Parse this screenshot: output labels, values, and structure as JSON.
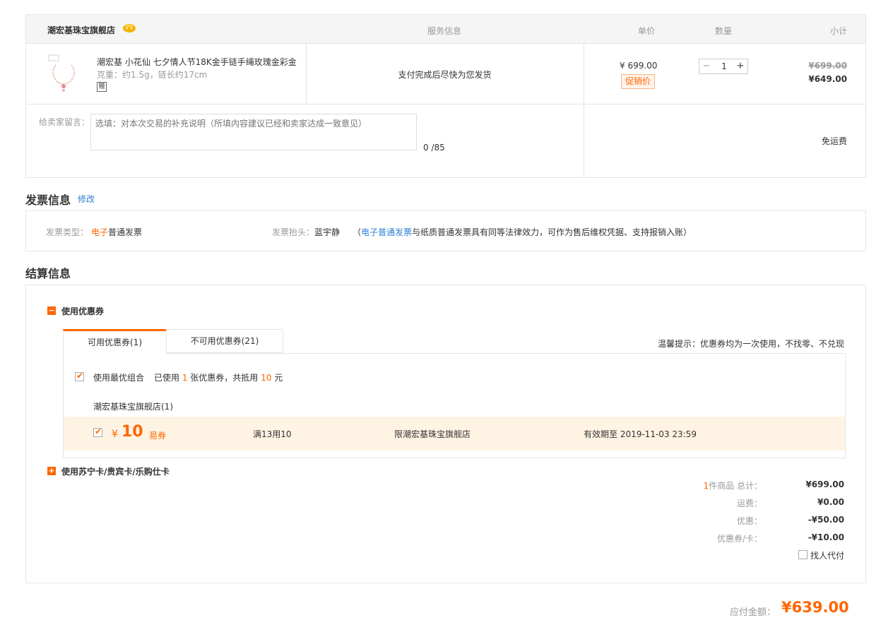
{
  "order": {
    "store_name": "潮宏基珠宝旗舰店",
    "headers": {
      "service": "服务信息",
      "unit_price": "单价",
      "quantity": "数量",
      "subtotal": "小计"
    },
    "item": {
      "title": "潮宏基 小花仙 七夕情人节18K金手链手绳玫瑰金彩金",
      "spec": "克重：约1.5g，链长约17cm",
      "tag": "赠",
      "service": "支付完成后尽快为您发货",
      "unit_price": "¥ 699.00",
      "promo_label": "促销价",
      "qty_minus": "−",
      "qty": "1",
      "qty_plus": "+",
      "old_price": "¥699.00",
      "new_price": "¥649.00"
    },
    "message": {
      "label": "给卖家留言：",
      "placeholder": "选填：对本次交易的补充说明（所填内容建议已经和卖家达成一致意见）",
      "count": "0 /85"
    },
    "shipping": "免运费"
  },
  "invoice": {
    "title": "发票信息",
    "edit": "修改",
    "type_label": "发票类型：",
    "type_value_a": "电子",
    "type_value_b": "普通发票",
    "head_label": "发票抬头：",
    "head_value": "蓝宇静",
    "note_open": "（",
    "note_link": "电子普通发票",
    "note_rest": "与纸质普通发票具有同等法律效力，可作为售后维权凭据、支持报销入账）"
  },
  "settlement": {
    "title": "结算信息",
    "coupon_toggle": "−",
    "coupon_label": "使用优惠券",
    "tabs": {
      "available": "可用优惠券(1)",
      "unavailable": "不可用优惠券(21)"
    },
    "tip": "温馨提示：优惠券均为一次使用，不找零、不兑现",
    "best": {
      "label": "使用最优组合",
      "used_a": "已使用 ",
      "used_count": "1",
      "used_b": " 张优惠券，共抵用 ",
      "used_amount": "10",
      "used_c": " 元"
    },
    "store_coupons": "潮宏基珠宝旗舰店(1)",
    "coupon": {
      "yen": "¥",
      "amount": "10",
      "type": "易券",
      "condition": "满13用10",
      "scope": "限潮宏基珠宝旗舰店",
      "expire": "有效期至 2019-11-03 23:59"
    },
    "card_toggle": "+",
    "card_label": "使用苏宁卡/贵宾卡/乐购仕卡",
    "summary": {
      "items_count": "1",
      "items_label": "件商品 总计：",
      "items_total": "¥699.00",
      "shipping_label": "运费：",
      "shipping": "¥0.00",
      "discount_label": "优惠：",
      "discount": "-¥50.00",
      "coupon_label": "优惠券/卡：",
      "coupon": "-¥10.00"
    },
    "proxy_label": "找人代付"
  },
  "payment": {
    "label": "应付金额：",
    "total": "¥639.00"
  },
  "colors": {
    "accent": "#ff6600",
    "link": "#2a7fd4",
    "border": "#e5e5e5",
    "coupon_bg": "#fff3e3"
  }
}
